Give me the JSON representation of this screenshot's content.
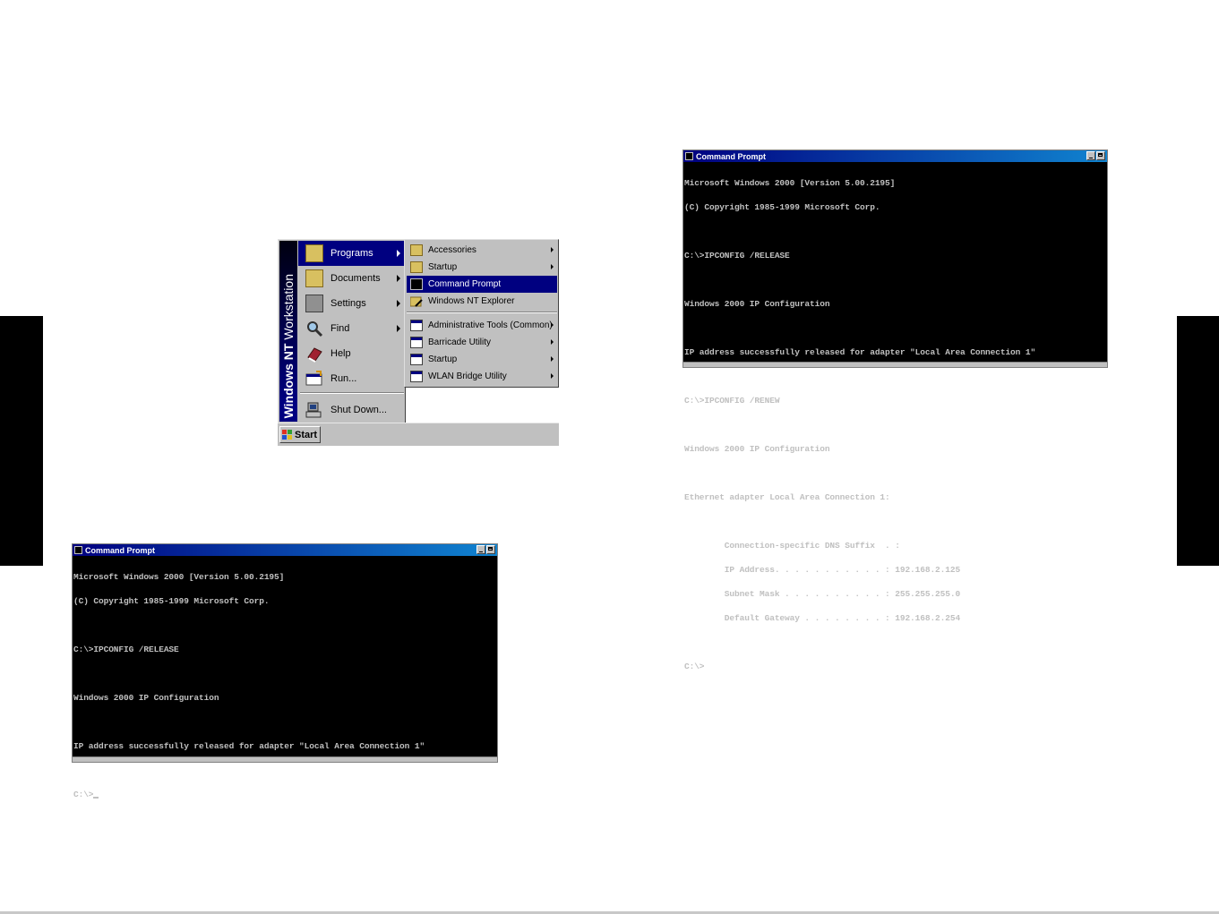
{
  "start_menu": {
    "banner_bold": "Windows NT",
    "banner_rest": " Workstation",
    "start_label": "Start",
    "main_items": [
      {
        "label": "Programs",
        "highlighted": true,
        "submenu": true,
        "icon": "programs-folder-icon"
      },
      {
        "label": "Documents",
        "highlighted": false,
        "submenu": true,
        "icon": "documents-folder-icon"
      },
      {
        "label": "Settings",
        "highlighted": false,
        "submenu": true,
        "icon": "settings-icon"
      },
      {
        "label": "Find",
        "highlighted": false,
        "submenu": true,
        "icon": "find-magnifier-icon"
      },
      {
        "label": "Help",
        "highlighted": false,
        "submenu": false,
        "icon": "help-book-icon"
      },
      {
        "label": "Run...",
        "highlighted": false,
        "submenu": false,
        "icon": "run-icon"
      }
    ],
    "shutdown_label": "Shut Down...",
    "programs_submenu": [
      {
        "label": "Accessories",
        "submenu": true,
        "highlighted": false
      },
      {
        "label": "Startup",
        "submenu": true,
        "highlighted": false
      },
      {
        "label": "Command Prompt",
        "submenu": false,
        "highlighted": true
      },
      {
        "label": "Windows NT Explorer",
        "submenu": false,
        "highlighted": false
      },
      {
        "label": "Administrative Tools (Common)",
        "submenu": true,
        "highlighted": false
      },
      {
        "label": "Barricade Utility",
        "submenu": true,
        "highlighted": false
      },
      {
        "label": "Startup",
        "submenu": true,
        "highlighted": false
      },
      {
        "label": "WLAN Bridge Utility",
        "submenu": true,
        "highlighted": false
      }
    ]
  },
  "cmd_release": {
    "title": "Command Prompt",
    "lines": [
      "Microsoft Windows 2000 [Version 5.00.2195]",
      "(C) Copyright 1985-1999 Microsoft Corp.",
      "",
      "C:\\>IPCONFIG /RELEASE",
      "",
      "Windows 2000 IP Configuration",
      "",
      "IP address successfully released for adapter \"Local Area Connection 1\"",
      "",
      "C:\\>"
    ]
  },
  "cmd_renew": {
    "title": "Command Prompt",
    "lines": [
      "Microsoft Windows 2000 [Version 5.00.2195]",
      "(C) Copyright 1985-1999 Microsoft Corp.",
      "",
      "C:\\>IPCONFIG /RELEASE",
      "",
      "Windows 2000 IP Configuration",
      "",
      "IP address successfully released for adapter \"Local Area Connection 1\"",
      "",
      "C:\\>IPCONFIG /RENEW",
      "",
      "Windows 2000 IP Configuration",
      "",
      "Ethernet adapter Local Area Connection 1:",
      "",
      "        Connection-specific DNS Suffix  . :",
      "        IP Address. . . . . . . . . . . : 192.168.2.125",
      "        Subnet Mask . . . . . . . . . . : 255.255.255.0",
      "        Default Gateway . . . . . . . . : 192.168.2.254",
      "",
      "C:\\>"
    ]
  },
  "colors": {
    "highlight": "#000080",
    "menu_face": "#c0c0c0",
    "console_bg": "#000000",
    "console_text": "#c0c0c0"
  }
}
